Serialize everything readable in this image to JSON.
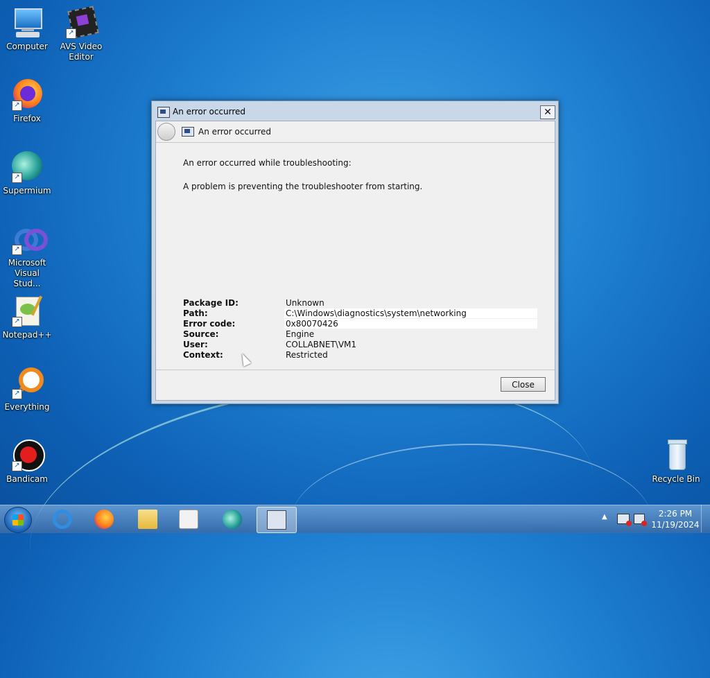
{
  "desktop": {
    "icons": [
      {
        "label": "Computer"
      },
      {
        "label": "AVS Video\nEditor"
      },
      {
        "label": "Firefox"
      },
      {
        "label": "Supermium"
      },
      {
        "label": "Microsoft\nVisual Stud..."
      },
      {
        "label": "Notepad++"
      },
      {
        "label": "Everything"
      },
      {
        "label": "Bandicam"
      },
      {
        "label": "Recycle Bin"
      }
    ]
  },
  "dialog": {
    "window_title": "An error occurred",
    "nav_title": "An error occurred",
    "message1": "An error occurred while troubleshooting:",
    "message2": "A problem is preventing the troubleshooter from starting.",
    "details": [
      {
        "key": "Package ID:",
        "value": "Unknown"
      },
      {
        "key": "Path:",
        "value": "C:\\Windows\\diagnostics\\system\\networking"
      },
      {
        "key": "Error code:",
        "value": "0x80070426"
      },
      {
        "key": "Source:",
        "value": "Engine"
      },
      {
        "key": "User:",
        "value": "COLLABNET\\VM1"
      },
      {
        "key": "Context:",
        "value": "Restricted"
      }
    ],
    "close_label": "Close",
    "close_x": "✕"
  },
  "taskbar": {
    "apps": [
      "start-button",
      "internet-explorer",
      "firefox",
      "file-explorer",
      "media-player",
      "supermium",
      "troubleshooter"
    ],
    "time": "2:26 PM",
    "date": "11/19/2024",
    "tray_arrow": "▲"
  }
}
